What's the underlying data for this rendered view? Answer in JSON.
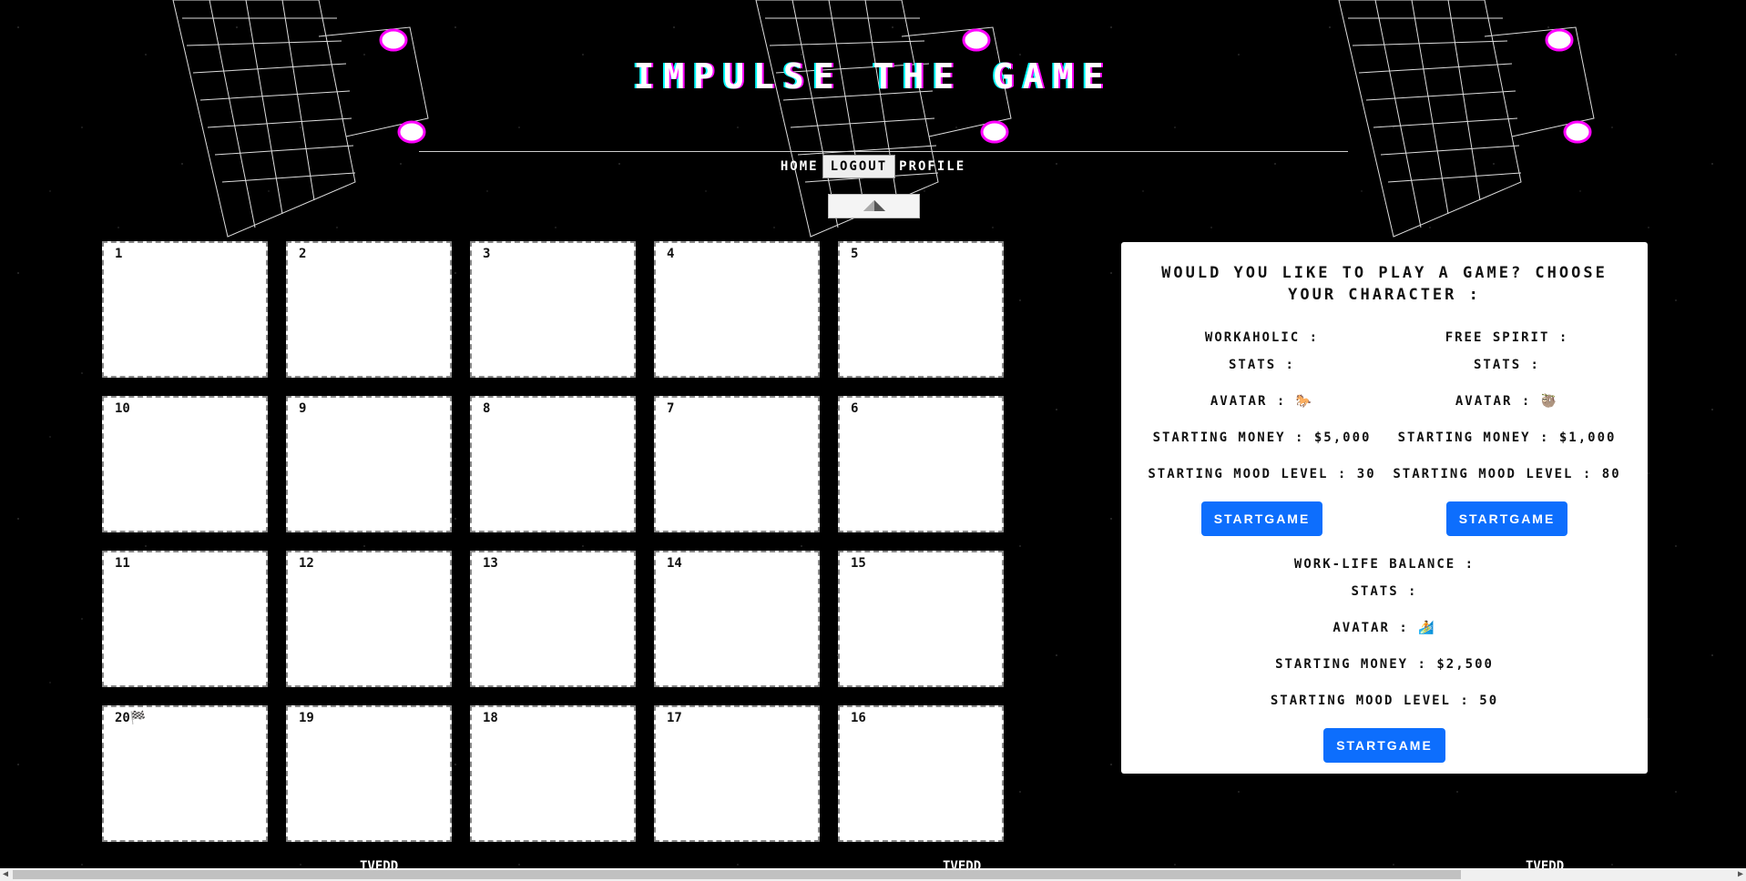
{
  "app": {
    "title": "IMPULSE THE GAME"
  },
  "nav": {
    "home": "HOME",
    "logout": "LOGOUT",
    "profile": "PROFILE",
    "toggle_icon": "pyramid-icon"
  },
  "board": {
    "rows": [
      [
        "1",
        "2",
        "3",
        "4",
        "5"
      ],
      [
        "10",
        "9",
        "8",
        "7",
        "6"
      ],
      [
        "11",
        "12",
        "13",
        "14",
        "15"
      ],
      [
        "20",
        "19",
        "18",
        "17",
        "16"
      ]
    ],
    "finish_icon": "flag-icon",
    "finish_glyph": "🏁"
  },
  "panel": {
    "title": "WOULD YOU LIKE TO PLAY A GAME? CHOOSE YOUR CHARACTER :",
    "characters": [
      {
        "name": "WORKAHOLIC :",
        "stats": "STATS :",
        "avatar_label": "AVATAR :",
        "avatar_glyph": "🐎",
        "avatar_icon": "horse-icon",
        "money": "STARTING MONEY : $5,000",
        "mood": "STARTING MOOD LEVEL : 30",
        "button": "STARTGAME"
      },
      {
        "name": "FREE SPIRIT :",
        "stats": "STATS :",
        "avatar_label": "AVATAR :",
        "avatar_glyph": "🦥",
        "avatar_icon": "sloth-icon",
        "money": "STARTING MONEY : $1,000",
        "mood": "STARTING MOOD LEVEL : 80",
        "button": "STARTGAME"
      },
      {
        "name": "WORK-LIFE BALANCE :",
        "stats": "STATS :",
        "avatar_label": "AVATAR :",
        "avatar_glyph": "🏄",
        "avatar_icon": "surfer-icon",
        "money": "STARTING MONEY : $2,500",
        "mood": "STARTING MOOD LEVEL : 50",
        "button": "STARTGAME"
      }
    ]
  },
  "footer": {
    "labels": [
      "TVEDD",
      "TVEDD",
      "TVEDD"
    ]
  },
  "colors": {
    "background": "#000000",
    "button": "#0d6efd",
    "cell": "#ffffff",
    "glitch_magenta": "#ff00ff",
    "glitch_cyan": "#00ffff"
  }
}
